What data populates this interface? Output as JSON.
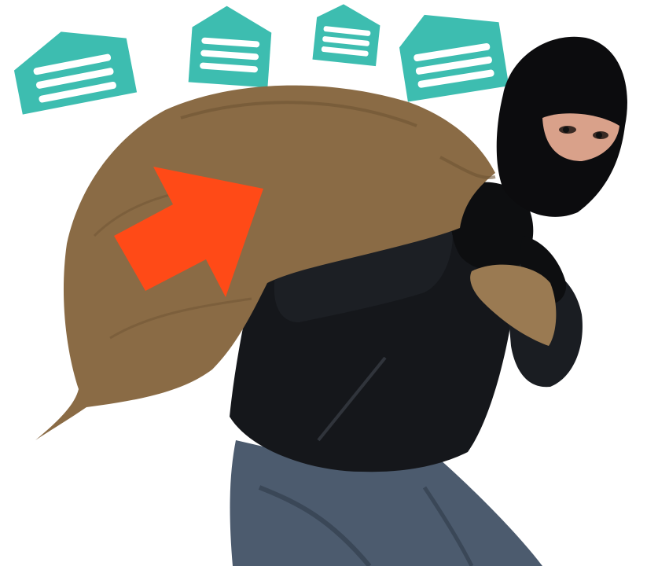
{
  "scene": {
    "background": "#ffffff",
    "icon_color": "#3dbdb0",
    "arrow_color": "#ff4a17",
    "sack_color": "#8a6b45",
    "jacket_color": "#15171b",
    "jeans_color": "#4c5b6e",
    "mask_color": "#0c0c0e",
    "skin_color": "#d9a18a"
  },
  "icons": [
    {
      "name": "envelope-icon"
    },
    {
      "name": "envelope-icon"
    },
    {
      "name": "envelope-icon"
    },
    {
      "name": "envelope-icon"
    }
  ],
  "figure": {
    "name": "burglar-carrying-sack"
  },
  "overlay": {
    "name": "arrow-icon"
  }
}
